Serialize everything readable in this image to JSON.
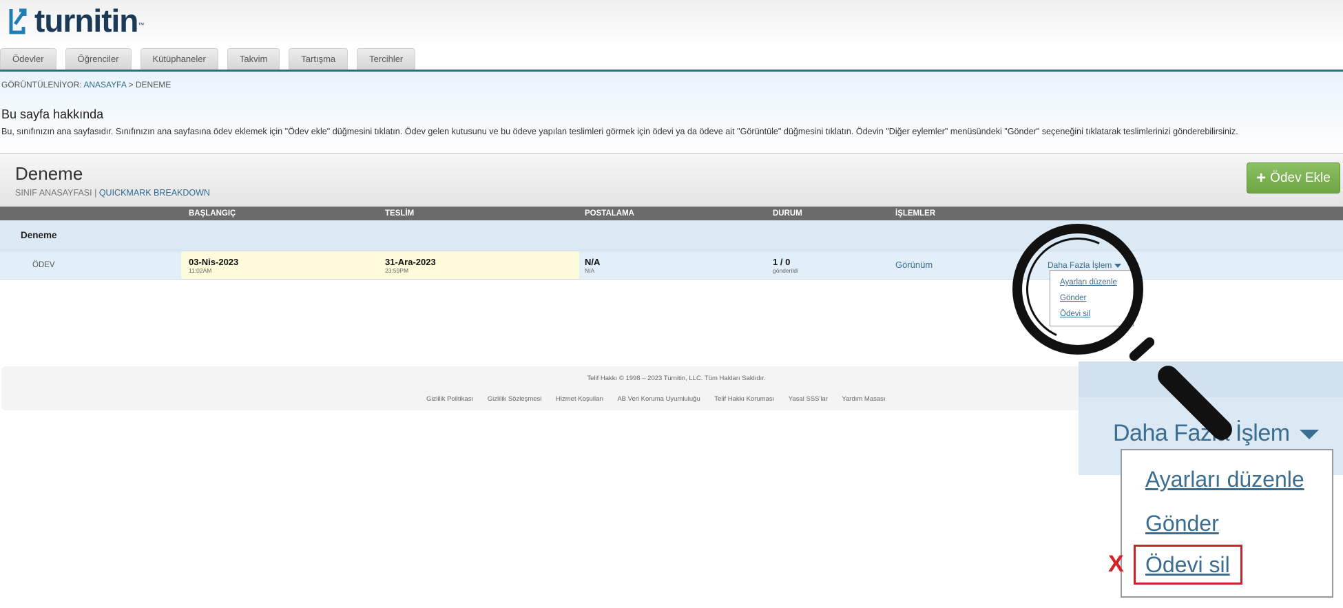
{
  "brand": {
    "name": "turnitin",
    "tm": "™",
    "accent": "#1b3a57"
  },
  "tabs": [
    "Ödevler",
    "Öğrenciler",
    "Kütüphaneler",
    "Takvim",
    "Tartışma",
    "Tercihler"
  ],
  "breadcrumb": {
    "prefix": "GÖRÜNTÜLENİYOR:",
    "home": "ANASAYFA",
    "sep": ">",
    "current": "DENEME"
  },
  "about": {
    "title": "Bu sayfa hakkında",
    "text": "Bu, sınıfınızın ana sayfasıdır. Sınıfınızın ana sayfasına ödev eklemek için \"Ödev ekle\" düğmesini tıklatın. Ödev gelen kutusunu ve bu ödeve yapılan teslimleri görmek için ödevi ya da ödeve ait \"Görüntüle\" düğmesini tıklatın. Ödevin \"Diğer eylemler\" menüsündeki \"Gönder\" seçeneğini tıklatarak teslimlerinizi gönderebilirsiniz."
  },
  "class": {
    "title": "Deneme",
    "sub_home": "SINIF ANASAYFASI",
    "sub_sep": "|",
    "sub_link": "QUICKMARK BREAKDOWN",
    "add_button": "Ödev Ekle"
  },
  "table": {
    "headers": [
      "BAŞLANGIÇ",
      "TESLİM",
      "POSTALAMA",
      "DURUM",
      "İŞLEMLER"
    ],
    "group": "Deneme",
    "row": {
      "type": "ÖDEV",
      "start_date": "03-Nis-2023",
      "start_time": "11:02AM",
      "due_date": "31-Ara-2023",
      "due_time": "23:59PM",
      "post": "N/A",
      "post_sub": "N/A",
      "status": "1 / 0",
      "status_sub": "gönderildi",
      "view": "Görünüm",
      "more": "Daha Fazla İşlem"
    }
  },
  "menu": [
    "Ayarları düzenle",
    "Gönder",
    "Ödevi sil"
  ],
  "footer": {
    "copyright": "Telif Hakkı © 1998 – 2023 Turnitin, LLC. Tüm Hakları Saklıdır.",
    "links": [
      "Gizlilik Politikası",
      "Gizlilik Sözleşmesi",
      "Hizmet Koşulları",
      "AB Veri Koruma Uyumluluğu",
      "Telif Hakkı Koruması",
      "Yasal SSS'lar",
      "Yardım Masası"
    ]
  },
  "zoom": {
    "marker": "X",
    "highlight_color": "#c8232c"
  }
}
